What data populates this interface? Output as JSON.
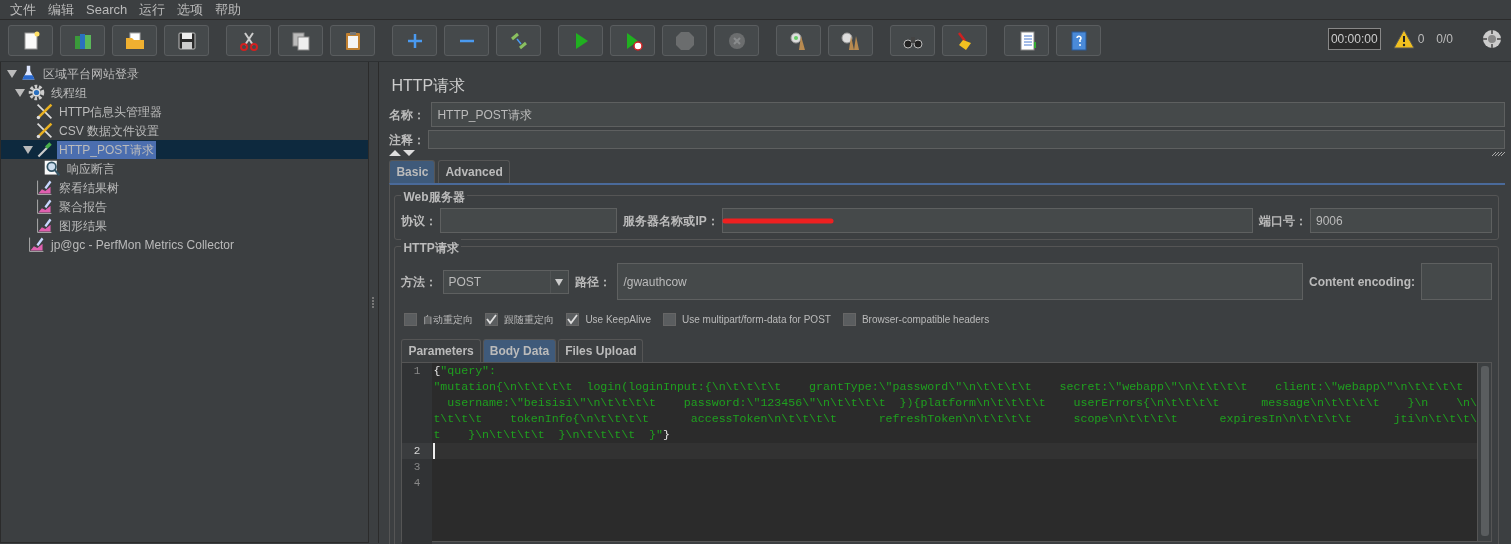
{
  "menu": [
    {
      "label": "文件"
    },
    {
      "label": "编辑"
    },
    {
      "label": "Search"
    },
    {
      "label": "运行"
    },
    {
      "label": "选项"
    },
    {
      "label": "帮助"
    }
  ],
  "toolbar": {
    "groups": [
      [
        {
          "kind": "new",
          "disabled": false
        },
        {
          "kind": "templates",
          "disabled": false
        },
        {
          "kind": "open",
          "disabled": false
        },
        {
          "kind": "save",
          "disabled": false
        }
      ],
      [
        {
          "kind": "cut",
          "disabled": false
        },
        {
          "kind": "copy",
          "disabled": false
        },
        {
          "kind": "paste",
          "disabled": false
        }
      ],
      [
        {
          "kind": "expand",
          "disabled": false
        },
        {
          "kind": "collapse",
          "disabled": false
        },
        {
          "kind": "toggle",
          "disabled": false
        }
      ],
      [
        {
          "kind": "start",
          "disabled": false
        },
        {
          "kind": "start_no_timers",
          "disabled": false
        },
        {
          "kind": "stop",
          "disabled": true
        },
        {
          "kind": "shutdown",
          "disabled": true
        }
      ],
      [
        {
          "kind": "clear",
          "disabled": false
        },
        {
          "kind": "clear_all",
          "disabled": false
        }
      ],
      [
        {
          "kind": "search",
          "disabled": false
        },
        {
          "kind": "reset_search",
          "disabled": false
        }
      ],
      [
        {
          "kind": "function",
          "disabled": false
        },
        {
          "kind": "help",
          "disabled": false
        }
      ]
    ],
    "timer": "00:00:00",
    "warnings": "0",
    "threads": "0/0"
  },
  "tree": [
    {
      "label": "区域平台网站登录",
      "kind": "testplan",
      "selected": false,
      "expanded": true,
      "children": [
        {
          "label": "线程组",
          "kind": "threadgroup",
          "selected": false,
          "expanded": true,
          "children": [
            {
              "label": "HTTP信息头管理器",
              "kind": "config",
              "selected": false
            },
            {
              "label": "CSV 数据文件设置",
              "kind": "config",
              "selected": false
            },
            {
              "label": "HTTP_POST请求",
              "kind": "sampler",
              "selected": true,
              "expanded": true,
              "children": [
                {
                  "label": "响应断言",
                  "kind": "assertion",
                  "selected": false
                }
              ]
            },
            {
              "label": "察看结果树",
              "kind": "listener",
              "selected": false
            },
            {
              "label": "聚合报告",
              "kind": "listener",
              "selected": false
            },
            {
              "label": "图形结果",
              "kind": "listener",
              "selected": false
            }
          ]
        },
        {
          "label": "jp@gc - PerfMon Metrics Collector",
          "kind": "listener",
          "selected": false
        }
      ]
    }
  ],
  "panel": {
    "title": "HTTP请求",
    "name_label": "名称：",
    "name_value": "HTTP_POST请求",
    "comment_label": "注释：",
    "tabs": [
      {
        "label": "Basic",
        "selected": true
      },
      {
        "label": "Advanced",
        "selected": false
      }
    ],
    "web_server": {
      "legend": "Web服务器",
      "protocol_label": "协议：",
      "server_label": "服务器名称或IP：",
      "server_redacted": true,
      "port_label": "端口号：",
      "port_value": "9006"
    },
    "http_request": {
      "legend": "HTTP请求",
      "method_label": "方法：",
      "method_value": "POST",
      "path_label": "路径：",
      "path_value": "/gwauthcow",
      "encoding_label": "Content encoding:",
      "checkboxes": [
        {
          "label": "自动重定向",
          "checked": false
        },
        {
          "label": "跟随重定向",
          "checked": true
        },
        {
          "label": "Use KeepAlive",
          "checked": true
        },
        {
          "label": "Use multipart/form-data for POST",
          "checked": false
        },
        {
          "label": "Browser-compatible headers",
          "checked": false
        }
      ]
    },
    "body_tabs": [
      {
        "label": "Parameters",
        "selected": false
      },
      {
        "label": "Body Data",
        "selected": true
      },
      {
        "label": "Files Upload",
        "selected": false
      }
    ],
    "editor": {
      "lines": [
        {
          "number": "1",
          "current": false,
          "rows": [
            {
              "lead": "{",
              "text": "\"query\":"
            },
            {
              "text": "\"mutation{\\n\\t\\t\\t\\t  login(loginInput:{\\n\\t\\t\\t\\t    grantType:\\\"password\\\"\\n\\t\\t\\t\\t    secret:\\\"webapp\\\"\\n\\t\\t\\t\\t    client:\\\"webapp\\\"\\n\\t\\t\\t\\t"
            },
            {
              "text": "  username:\\\"beisisi\\\"\\n\\t\\t\\t\\t    password:\\\"123456\\\"\\n\\t\\t\\t\\t  }){platform\\n\\t\\t\\t\\t    userErrors{\\n\\t\\t\\t\\t      message\\n\\t\\t\\t\\t    }\\n    \\n\\"
            },
            {
              "text": "t\\t\\t\\t    tokenInfo{\\n\\t\\t\\t\\t      accessToken\\n\\t\\t\\t\\t      refreshToken\\n\\t\\t\\t\\t      scope\\n\\t\\t\\t\\t      expiresIn\\n\\t\\t\\t\\t      jti\\n\\t\\t\\t\\"
            },
            {
              "text": "t    }\\n\\t\\t\\t\\t  }\\n\\t\\t\\t\\t  }\"",
              "trail": "}"
            }
          ]
        },
        {
          "number": "2",
          "current": true
        },
        {
          "number": "3",
          "current": false
        },
        {
          "number": "4",
          "current": false
        }
      ]
    }
  }
}
